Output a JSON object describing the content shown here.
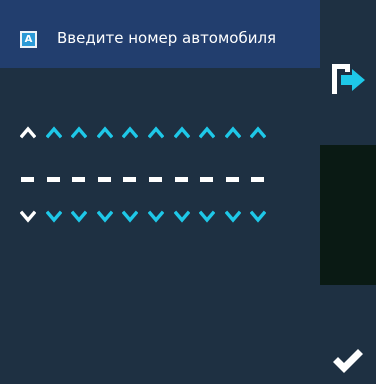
{
  "header": {
    "icon_letter": "A",
    "icon": "license-plate-field-icon",
    "title": "Введите номер автомобиля"
  },
  "plate_input": {
    "slot_count": 10,
    "active_slot": 0,
    "up_icon": "chevron-up-icon",
    "down_icon": "chevron-down-icon",
    "colors": {
      "active": "#ffffff",
      "inactive": "#1ec8e8",
      "slot": "#ffffff"
    }
  },
  "side_panel": {
    "exit_icon": "exit-arrow-icon",
    "confirm_icon": "checkmark-icon"
  },
  "colors": {
    "header_bg": "#223e6e",
    "body_bg": "#1e3042",
    "confirm_bg": "#0a1a14"
  }
}
